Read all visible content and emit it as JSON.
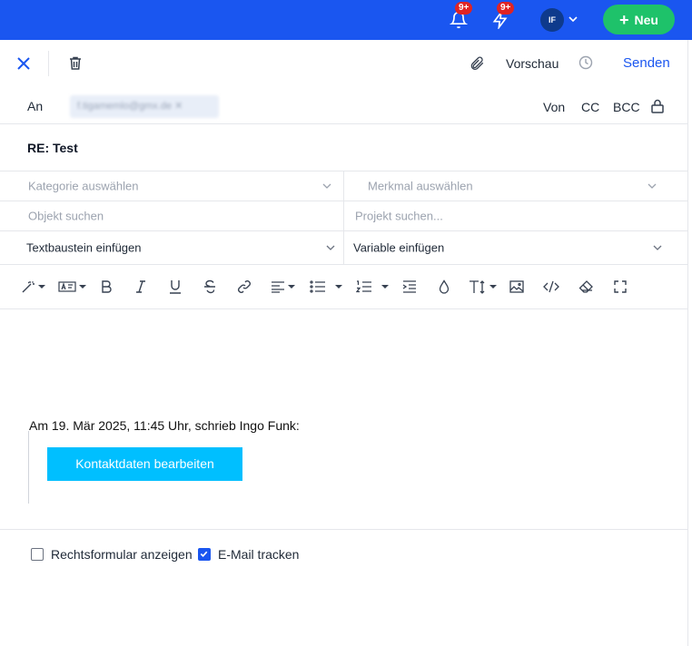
{
  "topbar": {
    "notifications_badge": "9+",
    "activity_badge": "9+",
    "avatar_initials": "IF",
    "new_button_label": "Neu",
    "colors": {
      "topbar_bg": "#1a56f0",
      "new_button_bg": "#1ec26a",
      "badge_bg": "#e02424"
    }
  },
  "compose": {
    "actions": {
      "preview_label": "Vorschau",
      "send_label": "Senden"
    },
    "recipients": {
      "to_label": "An",
      "to_value": "f.tigamemlo@gmx.de ✕",
      "from_label": "Von",
      "cc_label": "CC",
      "bcc_label": "BCC"
    },
    "subject": "RE: Test",
    "fields": {
      "category_placeholder": "Kategorie auswählen",
      "feature_placeholder": "Merkmal auswählen",
      "object_placeholder": "Objekt suchen",
      "project_placeholder": "Projekt suchen...",
      "textblock_label": "Textbaustein einfügen",
      "variable_label": "Variable einfügen"
    },
    "toolbar_icons": [
      "magic-wand-icon",
      "text-format-icon",
      "bold-icon",
      "italic-icon",
      "underline-icon",
      "strikethrough-icon",
      "link-icon",
      "align-icon",
      "bullet-list-icon",
      "numbered-list-icon",
      "indent-icon",
      "color-drop-icon",
      "font-size-icon",
      "image-icon",
      "code-icon",
      "eraser-icon",
      "fullscreen-icon"
    ],
    "editor": {
      "quote_header": "Am 19. Mär 2025, 11:45 Uhr, schrieb Ingo Funk:",
      "contact_button": "Kontaktdaten bearbeiten",
      "contact_button_color": "#00bfff"
    },
    "options": {
      "legal_form_label": "Rechtsformular anzeigen",
      "legal_form_checked": false,
      "tracking_label": "E-Mail tracken",
      "tracking_checked": true
    }
  }
}
